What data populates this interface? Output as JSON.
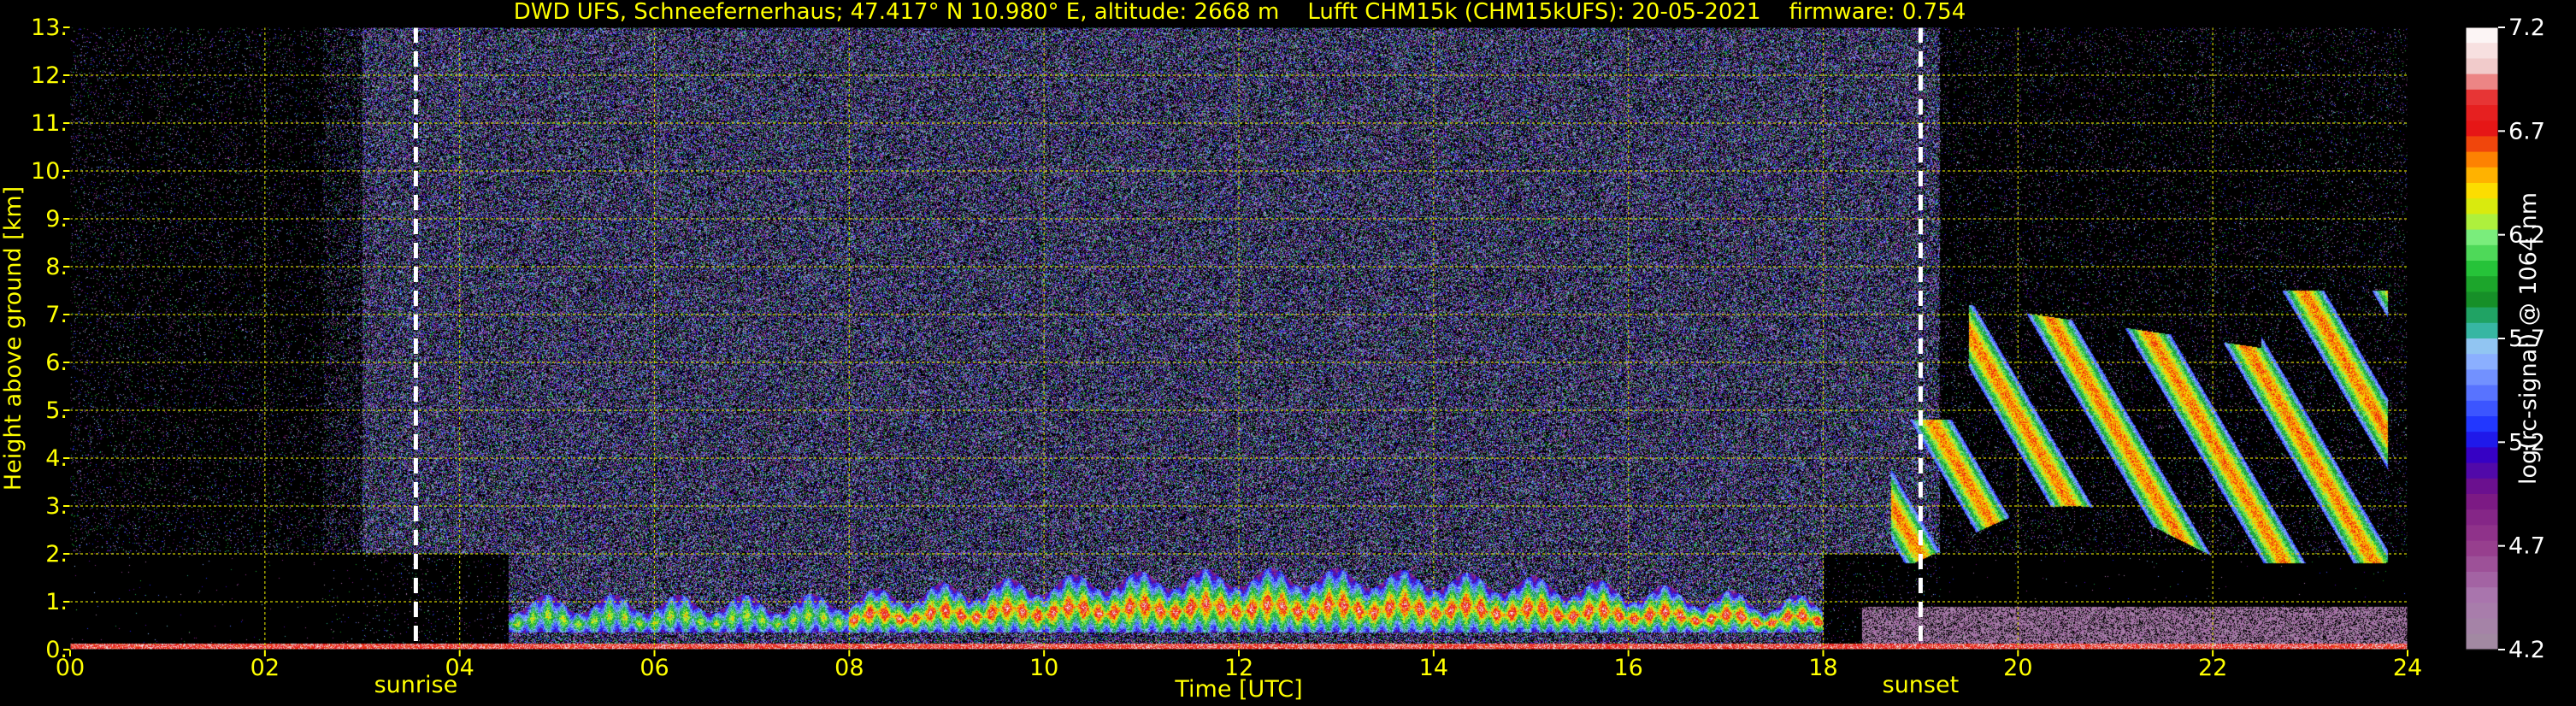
{
  "chart_data": {
    "type": "heatmap",
    "title": "DWD UFS, Schneefernerhaus; 47.417° N 10.980° E, altitude: 2668 m    Lufft CHM15k (CHM15kUFS): 20-05-2021    firmware: 0.754",
    "xlabel": "Time [UTC]",
    "ylabel": "Height above ground [km]",
    "xlim": [
      0,
      24
    ],
    "ylim": [
      0,
      13
    ],
    "x_ticks": [
      "00",
      "02",
      "04",
      "06",
      "08",
      "10",
      "12",
      "14",
      "16",
      "18",
      "20",
      "22",
      "24"
    ],
    "y_ticks": [
      "0.",
      "1.",
      "2.",
      "3.",
      "4.",
      "5.",
      "6.",
      "7.",
      "8.",
      "9.",
      "10.",
      "11.",
      "12.",
      "13."
    ],
    "grid": true,
    "markers": [
      {
        "label": "sunrise",
        "time": 3.55
      },
      {
        "label": "sunset",
        "time": 19.0
      }
    ],
    "colorbar": {
      "label": "log(rc-signal) @ 1064 nm",
      "min": 4.2,
      "max": 7.2,
      "ticks": [
        "7.2",
        "6.7",
        "6.2",
        "5.7",
        "5.2",
        "4.7",
        "4.2"
      ]
    },
    "features": [
      {
        "name": "boundary layer aerosol / cloud layer",
        "time_range": [
          4.5,
          18.0
        ],
        "height_range": [
          0.3,
          1.8
        ]
      },
      {
        "name": "cirrus / high cloud",
        "time_range": [
          18.7,
          23.8
        ],
        "height_range": [
          1.8,
          8.3
        ]
      }
    ]
  },
  "colors": {
    "background": "#000000",
    "text": "#ffff00",
    "grid": "#cccc00",
    "marker": "#ffffff",
    "colorbar_label": "#ffffff"
  }
}
